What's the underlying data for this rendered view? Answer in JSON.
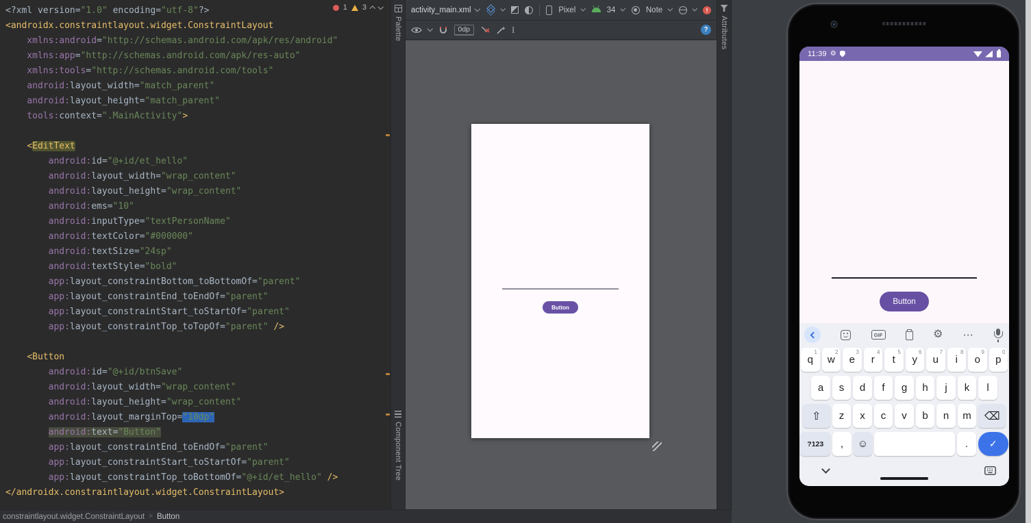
{
  "editor": {
    "problems": {
      "errors": "1",
      "warnings": "3"
    },
    "breadcrumb": [
      "constraintlayout.widget.ConstraintLayout",
      "Button"
    ],
    "code": [
      [
        [
          "pi",
          "<?xml "
        ],
        [
          "attr",
          "version"
        ],
        [
          "eq",
          "="
        ],
        [
          "val",
          "\"1.0\""
        ],
        [
          "pi",
          " "
        ],
        [
          "attr",
          "encoding"
        ],
        [
          "eq",
          "="
        ],
        [
          "val",
          "\"utf-8\""
        ],
        [
          "pi",
          "?>"
        ]
      ],
      [
        [
          "tag",
          "<androidx.constraintlayout.widget.ConstraintLayout"
        ]
      ],
      [
        [
          "ns",
          "    xmlns:android"
        ],
        [
          "eq",
          "="
        ],
        [
          "val",
          "\"http://schemas.android.com/apk/res/android\""
        ]
      ],
      [
        [
          "ns",
          "    xmlns:app"
        ],
        [
          "eq",
          "="
        ],
        [
          "val",
          "\"http://schemas.android.com/apk/res-auto\""
        ]
      ],
      [
        [
          "ns",
          "    xmlns:tools"
        ],
        [
          "eq",
          "="
        ],
        [
          "val",
          "\"http://schemas.android.com/tools\""
        ]
      ],
      [
        [
          "ns",
          "    android:"
        ],
        [
          "attr",
          "layout_width"
        ],
        [
          "eq",
          "="
        ],
        [
          "val",
          "\"match_parent\""
        ]
      ],
      [
        [
          "ns",
          "    android:"
        ],
        [
          "attr",
          "layout_height"
        ],
        [
          "eq",
          "="
        ],
        [
          "val",
          "\"match_parent\""
        ]
      ],
      [
        [
          "ns",
          "    tools:"
        ],
        [
          "attr",
          "context"
        ],
        [
          "eq",
          "="
        ],
        [
          "val",
          "\".MainActivity\""
        ],
        [
          "tag",
          ">"
        ]
      ],
      [],
      [
        [
          "plain",
          "    "
        ],
        [
          "tag",
          "<"
        ],
        [
          "tag hl-ident",
          "EditText"
        ]
      ],
      [
        [
          "ns",
          "        android:"
        ],
        [
          "attr",
          "id"
        ],
        [
          "eq",
          "="
        ],
        [
          "val",
          "\"@+id/et_hello\""
        ]
      ],
      [
        [
          "ns",
          "        android:"
        ],
        [
          "attr",
          "layout_width"
        ],
        [
          "eq",
          "="
        ],
        [
          "val",
          "\"wrap_content\""
        ]
      ],
      [
        [
          "ns",
          "        android:"
        ],
        [
          "attr",
          "layout_height"
        ],
        [
          "eq",
          "="
        ],
        [
          "val",
          "\"wrap_content\""
        ]
      ],
      [
        [
          "ns",
          "        android:"
        ],
        [
          "attr",
          "ems"
        ],
        [
          "eq",
          "="
        ],
        [
          "val",
          "\"10\""
        ]
      ],
      [
        [
          "ns",
          "        android:"
        ],
        [
          "attr",
          "inputType"
        ],
        [
          "eq",
          "="
        ],
        [
          "val",
          "\"textPersonName\""
        ]
      ],
      [
        [
          "ns",
          "        android:"
        ],
        [
          "attr",
          "textColor"
        ],
        [
          "eq",
          "="
        ],
        [
          "val",
          "\"#000000\""
        ]
      ],
      [
        [
          "ns",
          "        android:"
        ],
        [
          "attr",
          "textSize"
        ],
        [
          "eq",
          "="
        ],
        [
          "val",
          "\"24sp\""
        ]
      ],
      [
        [
          "ns",
          "        android:"
        ],
        [
          "attr",
          "textStyle"
        ],
        [
          "eq",
          "="
        ],
        [
          "val",
          "\"bold\""
        ]
      ],
      [
        [
          "ns",
          "        app:"
        ],
        [
          "attr",
          "layout_constraintBottom_toBottomOf"
        ],
        [
          "eq",
          "="
        ],
        [
          "val",
          "\"parent\""
        ]
      ],
      [
        [
          "ns",
          "        app:"
        ],
        [
          "attr",
          "layout_constraintEnd_toEndOf"
        ],
        [
          "eq",
          "="
        ],
        [
          "val",
          "\"parent\""
        ]
      ],
      [
        [
          "ns",
          "        app:"
        ],
        [
          "attr",
          "layout_constraintStart_toStartOf"
        ],
        [
          "eq",
          "="
        ],
        [
          "val",
          "\"parent\""
        ]
      ],
      [
        [
          "ns",
          "        app:"
        ],
        [
          "attr",
          "layout_constraintTop_toTopOf"
        ],
        [
          "eq",
          "="
        ],
        [
          "val",
          "\"parent\""
        ],
        [
          "tag",
          " />"
        ]
      ],
      [],
      [
        [
          "plain",
          "    "
        ],
        [
          "tag",
          "<Button"
        ]
      ],
      [
        [
          "ns",
          "        android:"
        ],
        [
          "attr",
          "id"
        ],
        [
          "eq",
          "="
        ],
        [
          "val",
          "\"@+id/btnSave\""
        ]
      ],
      [
        [
          "ns",
          "        android:"
        ],
        [
          "attr",
          "layout_width"
        ],
        [
          "eq",
          "="
        ],
        [
          "val",
          "\"wrap_content\""
        ]
      ],
      [
        [
          "ns",
          "        android:"
        ],
        [
          "attr",
          "layout_height"
        ],
        [
          "eq",
          "="
        ],
        [
          "val",
          "\"wrap_content\""
        ]
      ],
      [
        [
          "ns",
          "        android:"
        ],
        [
          "attr",
          "layout_marginTop"
        ],
        [
          "eq",
          "="
        ],
        [
          "sel val",
          "\"10dp\""
        ]
      ],
      [
        [
          "plain",
          "        "
        ],
        [
          "hlg ns",
          "android:"
        ],
        [
          "hlg attr",
          "text"
        ],
        [
          "hlg eq",
          "="
        ],
        [
          "hlg val",
          "\"Button\""
        ]
      ],
      [
        [
          "ns",
          "        app:"
        ],
        [
          "attr",
          "layout_constraintEnd_toEndOf"
        ],
        [
          "eq",
          "="
        ],
        [
          "val",
          "\"parent\""
        ]
      ],
      [
        [
          "ns",
          "        app:"
        ],
        [
          "attr",
          "layout_constraintStart_toStartOf"
        ],
        [
          "eq",
          "="
        ],
        [
          "val",
          "\"parent\""
        ]
      ],
      [
        [
          "ns",
          "        app:"
        ],
        [
          "attr",
          "layout_constraintTop_toBottomOf"
        ],
        [
          "eq",
          "="
        ],
        [
          "val",
          "\"@+id/et_hello\""
        ],
        [
          "tag",
          " />"
        ]
      ],
      [
        [
          "tag",
          "</androidx.constraintlayout.widget.ConstraintLayout>"
        ]
      ]
    ]
  },
  "design": {
    "tab_label": "activity_main.xml",
    "device_label": "Pixel",
    "api_label": "34",
    "theme_label": "Note",
    "margin_label": "0dp",
    "error_badge": "!",
    "help_label": "?",
    "palette_label": "Palette",
    "component_tree_label": "Component Tree",
    "attributes_label": "Attributes",
    "preview_button_label": "Button"
  },
  "phone": {
    "status_time": "11:39",
    "button_label": "Button",
    "keyboard": {
      "gif_label": "GIF",
      "gear_glyph": "⚙",
      "more_glyph": "⋯",
      "rows": [
        [
          {
            "label": "q",
            "sup": "1",
            "name": "key-q"
          },
          {
            "label": "w",
            "sup": "2",
            "name": "key-w"
          },
          {
            "label": "e",
            "sup": "3",
            "name": "key-e"
          },
          {
            "label": "r",
            "sup": "4",
            "name": "key-r"
          },
          {
            "label": "t",
            "sup": "5",
            "name": "key-t"
          },
          {
            "label": "y",
            "sup": "6",
            "name": "key-y"
          },
          {
            "label": "u",
            "sup": "7",
            "name": "key-u"
          },
          {
            "label": "i",
            "sup": "8",
            "name": "key-i"
          },
          {
            "label": "o",
            "sup": "9",
            "name": "key-o"
          },
          {
            "label": "p",
            "sup": "0",
            "name": "key-p"
          }
        ],
        [
          {
            "label": "a",
            "name": "key-a"
          },
          {
            "label": "s",
            "name": "key-s"
          },
          {
            "label": "d",
            "name": "key-d"
          },
          {
            "label": "f",
            "name": "key-f"
          },
          {
            "label": "g",
            "name": "key-g"
          },
          {
            "label": "h",
            "name": "key-h"
          },
          {
            "label": "j",
            "name": "key-j"
          },
          {
            "label": "k",
            "name": "key-k"
          },
          {
            "label": "l",
            "name": "key-l"
          }
        ],
        [
          {
            "label": "⇧",
            "name": "shift-key",
            "cls": "fn w40 big"
          },
          {
            "label": "z",
            "name": "key-z"
          },
          {
            "label": "x",
            "name": "key-x"
          },
          {
            "label": "c",
            "name": "key-c"
          },
          {
            "label": "v",
            "name": "key-v"
          },
          {
            "label": "b",
            "name": "key-b"
          },
          {
            "label": "n",
            "name": "key-n"
          },
          {
            "label": "m",
            "name": "key-m"
          },
          {
            "label": "⌫",
            "name": "backspace-key",
            "cls": "fn w40 big"
          }
        ],
        [
          {
            "label": "?123",
            "name": "symbols-key",
            "cls": "fn w44 small"
          },
          {
            "label": ",",
            "name": "comma-key"
          },
          {
            "label": "☺",
            "name": "emoji-key",
            "cls": "fn"
          },
          {
            "label": "",
            "name": "space-key",
            "cls": "space"
          },
          {
            "label": ".",
            "name": "period-key"
          },
          {
            "label": "✓",
            "name": "enter-key",
            "cls": "enter w44"
          }
        ]
      ]
    }
  }
}
